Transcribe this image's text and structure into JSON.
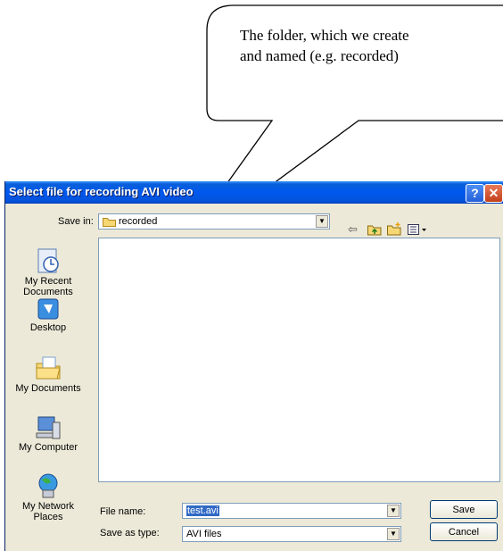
{
  "callout": {
    "line1": "The folder, which we create",
    "line2": "and named (e.g. recorded)"
  },
  "dialog": {
    "title": "Select file for recording AVI video",
    "help_glyph": "?",
    "close_glyph": "✕",
    "save_in_label": "Save in:",
    "save_in_value": "recorded",
    "places": [
      {
        "label": "My Recent Documents",
        "icon": "recent-documents-icon"
      },
      {
        "label": "Desktop",
        "icon": "desktop-icon"
      },
      {
        "label": "My Documents",
        "icon": "my-documents-icon"
      },
      {
        "label": "My Computer",
        "icon": "my-computer-icon"
      },
      {
        "label": "My Network Places",
        "icon": "network-places-icon"
      }
    ],
    "file_name_label": "File name:",
    "file_name_value": "test.avi",
    "save_as_type_label": "Save as type:",
    "save_as_type_value": "AVI files",
    "save_button": "Save",
    "cancel_button": "Cancel",
    "toolbar": {
      "back": "back-icon",
      "up": "up-folder-icon",
      "new_folder": "new-folder-icon",
      "views": "views-menu-icon"
    }
  }
}
